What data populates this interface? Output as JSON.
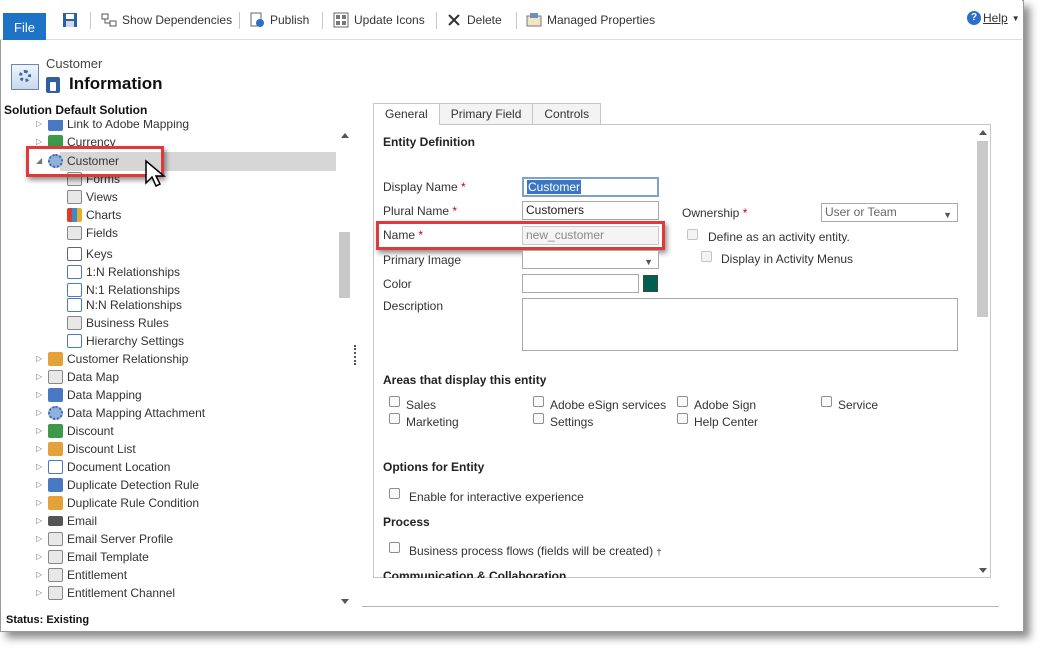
{
  "ribbon": {
    "file": "File",
    "show_dependencies": "Show Dependencies",
    "publish": "Publish",
    "update_icons": "Update Icons",
    "delete": "Delete",
    "managed_properties": "Managed Properties",
    "help": "Help"
  },
  "header": {
    "entity": "Customer",
    "title": "Information",
    "solution": "Solution Default Solution"
  },
  "tree": {
    "partial_top": "Link to Adobe Mapping",
    "currency": "Currency",
    "customer": "Customer",
    "children": [
      "Forms",
      "Views",
      "Charts",
      "Fields",
      "Keys",
      "1:N Relationships",
      "N:1 Relationships",
      "N:N Relationships",
      "Business Rules",
      "Hierarchy Settings"
    ],
    "items": [
      "Customer Relationship",
      "Data Map",
      "Data Mapping",
      "Data Mapping Attachment",
      "Discount",
      "Discount List",
      "Document Location",
      "Duplicate Detection Rule",
      "Duplicate Rule Condition",
      "Email",
      "Email Server Profile",
      "Email Template",
      "Entitlement",
      "Entitlement Channel"
    ]
  },
  "tabs": [
    "General",
    "Primary Field",
    "Controls"
  ],
  "form": {
    "entity_definition": "Entity Definition",
    "display_name_label": "Display Name",
    "display_name_value": "Customer",
    "plural_name_label": "Plural Name",
    "plural_name_value": "Customers",
    "name_label": "Name",
    "name_value": "new_customer",
    "primary_image_label": "Primary Image",
    "color_label": "Color",
    "description_label": "Description",
    "ownership_label": "Ownership",
    "ownership_value": "User or Team",
    "define_activity": "Define as an activity entity.",
    "display_activity_menus": "Display in Activity Menus",
    "required_marker": "*",
    "color_swatch": "#006050"
  },
  "areas": {
    "title": "Areas that display this entity",
    "items": [
      "Sales",
      "Marketing",
      "Adobe eSign services",
      "Settings",
      "Adobe Sign",
      "Help Center",
      "Service"
    ]
  },
  "options": {
    "title": "Options for Entity",
    "interactive": "Enable for interactive experience"
  },
  "process": {
    "title": "Process",
    "bpf": "Business process flows (fields will be created)",
    "bpf_marker": "†"
  },
  "communication": {
    "title": "Communication & Collaboration"
  },
  "status": "Status: Existing"
}
